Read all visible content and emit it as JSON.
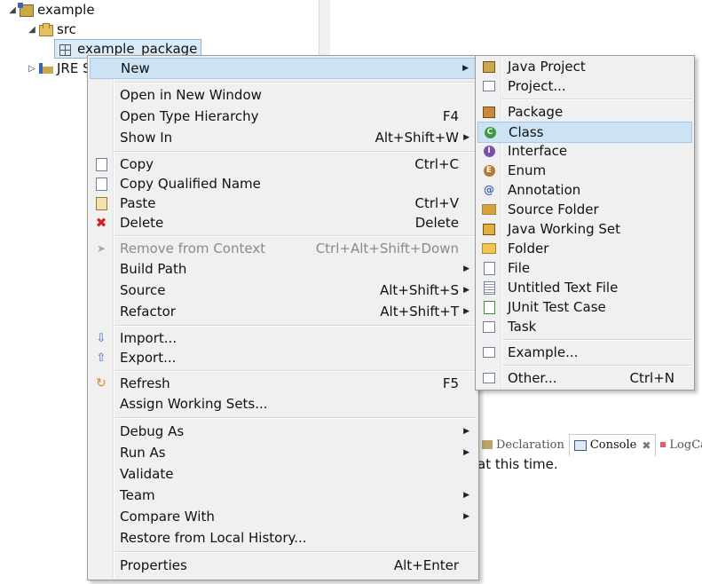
{
  "tree": {
    "project": "example",
    "src": "src",
    "package": "example_package",
    "jre": "JRE S"
  },
  "bottom_view": {
    "tabs": [
      "Declaration",
      "Console",
      "LogCat"
    ],
    "console_text": "at this time."
  },
  "context_menu": {
    "new": "New",
    "open_new_window": "Open in New Window",
    "open_type_hierarchy": "Open Type Hierarchy",
    "open_type_hierarchy_acc": "F4",
    "show_in": "Show In",
    "show_in_acc": "Alt+Shift+W",
    "copy": "Copy",
    "copy_acc": "Ctrl+C",
    "copy_qualified": "Copy Qualified Name",
    "paste": "Paste",
    "paste_acc": "Ctrl+V",
    "delete": "Delete",
    "delete_acc": "Delete",
    "remove_context": "Remove from Context",
    "remove_context_acc": "Ctrl+Alt+Shift+Down",
    "build_path": "Build Path",
    "source": "Source",
    "source_acc": "Alt+Shift+S",
    "refactor": "Refactor",
    "refactor_acc": "Alt+Shift+T",
    "import": "Import...",
    "export": "Export...",
    "refresh": "Refresh",
    "refresh_acc": "F5",
    "assign_working_sets": "Assign Working Sets...",
    "debug_as": "Debug As",
    "run_as": "Run As",
    "validate": "Validate",
    "team": "Team",
    "compare_with": "Compare With",
    "restore_history": "Restore from Local History...",
    "properties": "Properties",
    "properties_acc": "Alt+Enter"
  },
  "new_submenu": {
    "java_project": "Java Project",
    "project": "Project...",
    "package": "Package",
    "class": "Class",
    "interface": "Interface",
    "enum": "Enum",
    "annotation": "Annotation",
    "source_folder": "Source Folder",
    "java_working_set": "Java Working Set",
    "folder": "Folder",
    "file": "File",
    "untitled_text_file": "Untitled Text File",
    "junit_test_case": "JUnit Test Case",
    "task": "Task",
    "example": "Example...",
    "other": "Other...",
    "other_acc": "Ctrl+N"
  },
  "colors": {
    "menu_bg": "#f0f0f0",
    "highlight": "#cce2f5",
    "delete_red": "#d42020"
  }
}
